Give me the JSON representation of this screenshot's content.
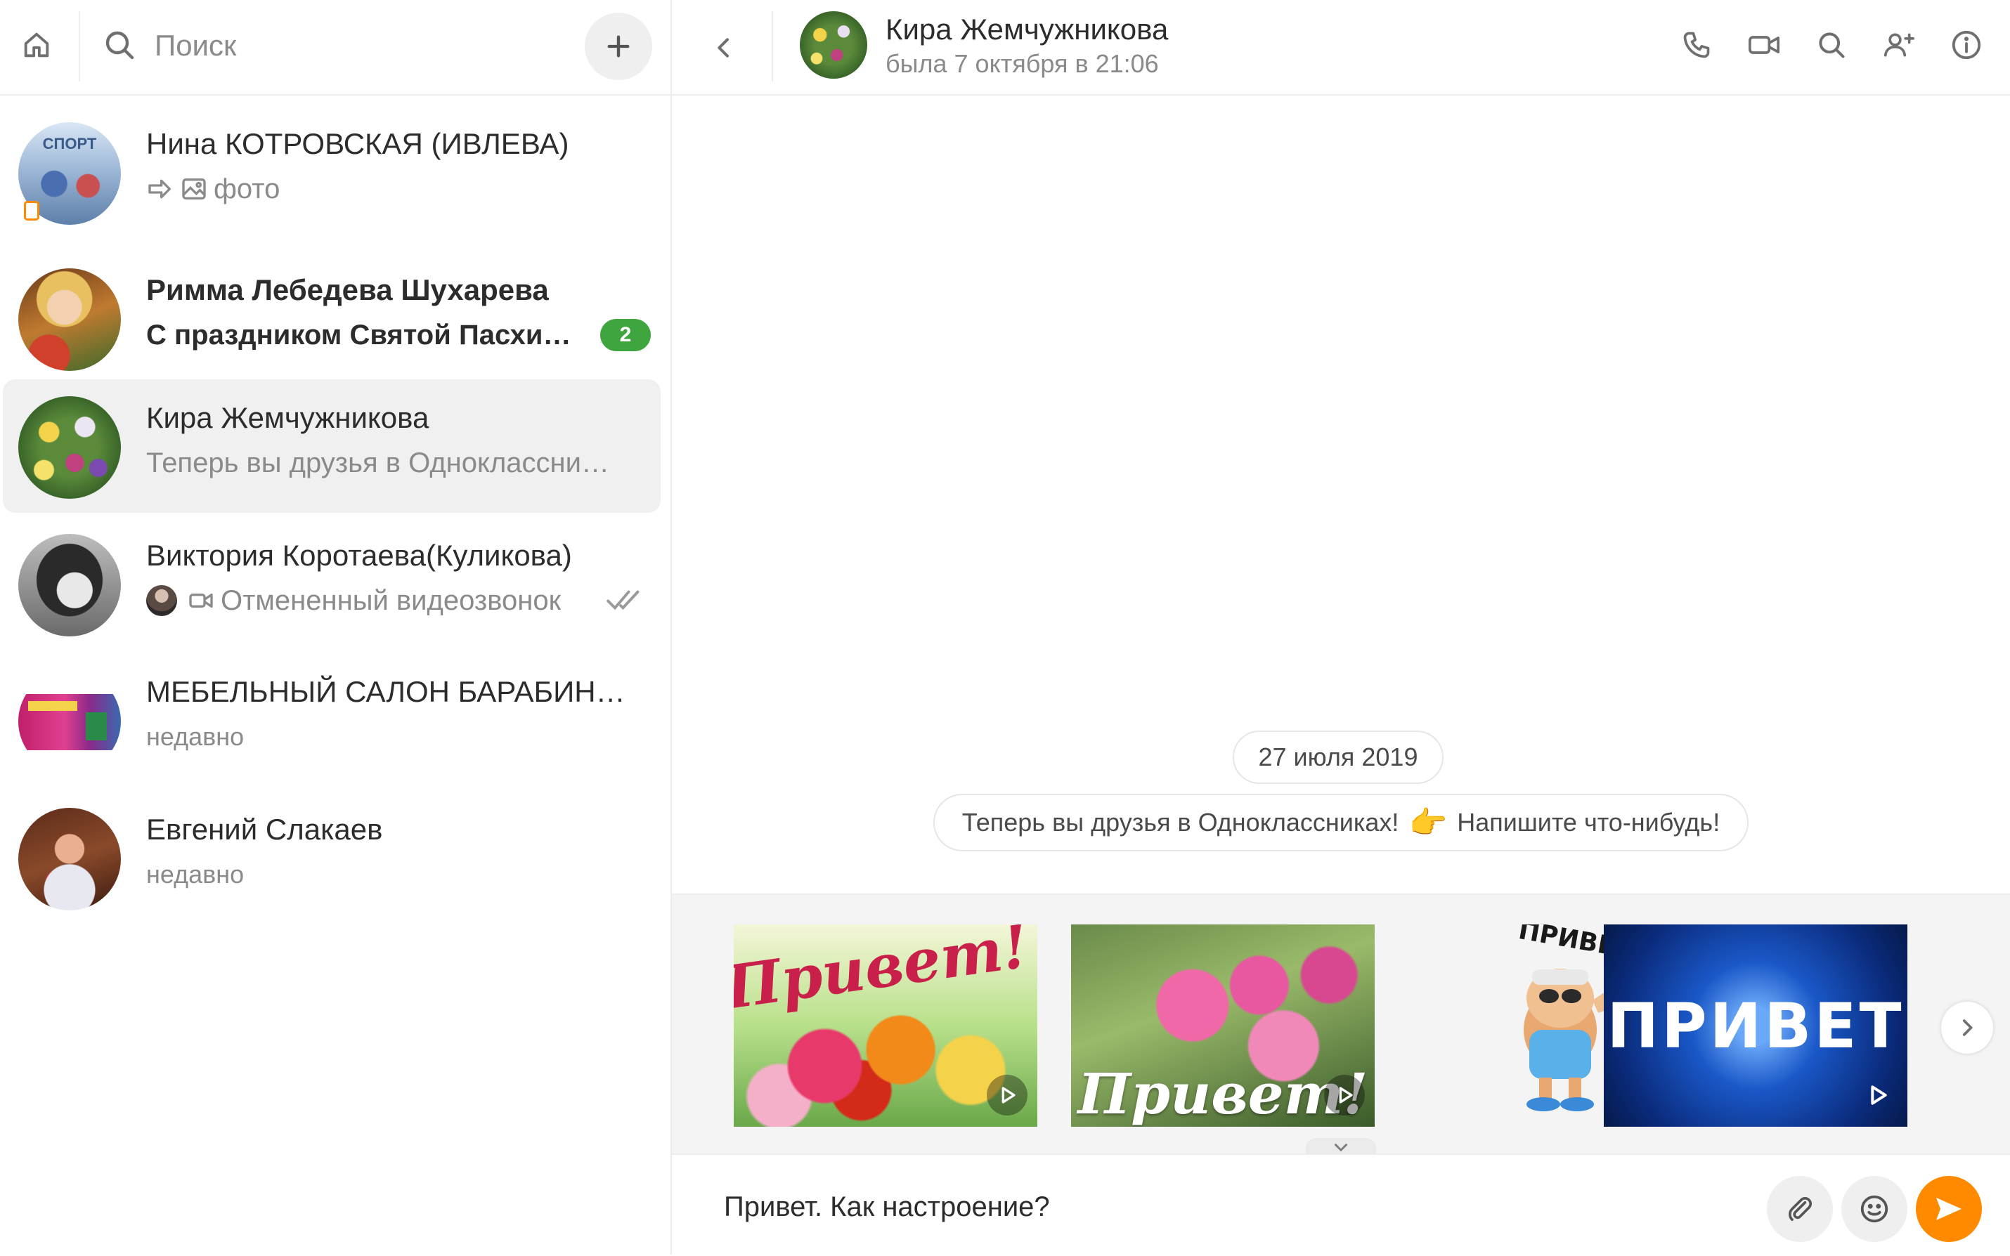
{
  "search": {
    "placeholder": "Поиск"
  },
  "chats": [
    {
      "name": "Нина КОТРОВСКАЯ (ИВЛЕВА)",
      "preview": "фото",
      "bold": false
    },
    {
      "name": "Римма Лебедева Шухарева",
      "preview": "С праздником Святой Пасхи…",
      "bold": true,
      "unread": "2"
    },
    {
      "name": "Кира Жемчужникова",
      "preview": "Теперь вы друзья в Одноклассни…",
      "bold": false,
      "active": true
    },
    {
      "name": "Виктория Коротаева(Куликова)",
      "preview": "Отмененный видеозвонок",
      "bold": false
    },
    {
      "name": "МЕБЕЛЬНЫЙ САЛОН БАРАБИН…",
      "preview": "недавно",
      "bold": false
    },
    {
      "name": "Евгений Слакаев",
      "preview": "недавно",
      "bold": false
    }
  ],
  "header": {
    "name": "Кира Жемчужникова",
    "status": "была 7 октября в 21:06"
  },
  "messages": {
    "date": "27 июля 2019",
    "system_before": "Теперь вы друзья в Одноклассниках!",
    "system_emoji": "👉",
    "system_after": "Напишите что-нибудь!"
  },
  "stickers": [
    {
      "caption": "Привет!",
      "type": "animated"
    },
    {
      "caption": "Привет!",
      "type": "animated"
    },
    {
      "caption": "ПРИВЕТ",
      "type": "static"
    },
    {
      "caption": "ПРИВЕТ",
      "type": "animated"
    }
  ],
  "composer": {
    "value": "Привет. Как настроение?"
  },
  "colors": {
    "accent": "#ff8a00",
    "unread_badge": "#3fa63f",
    "muted": "#8a8a8a"
  },
  "icons": [
    "home-icon",
    "search-icon",
    "plus-icon",
    "back-icon",
    "phone-icon",
    "video-icon",
    "search-icon",
    "add-user-icon",
    "info-icon",
    "attach-icon",
    "emoji-icon",
    "send-icon",
    "chevron-right-icon",
    "chevron-down-icon",
    "play-icon"
  ]
}
